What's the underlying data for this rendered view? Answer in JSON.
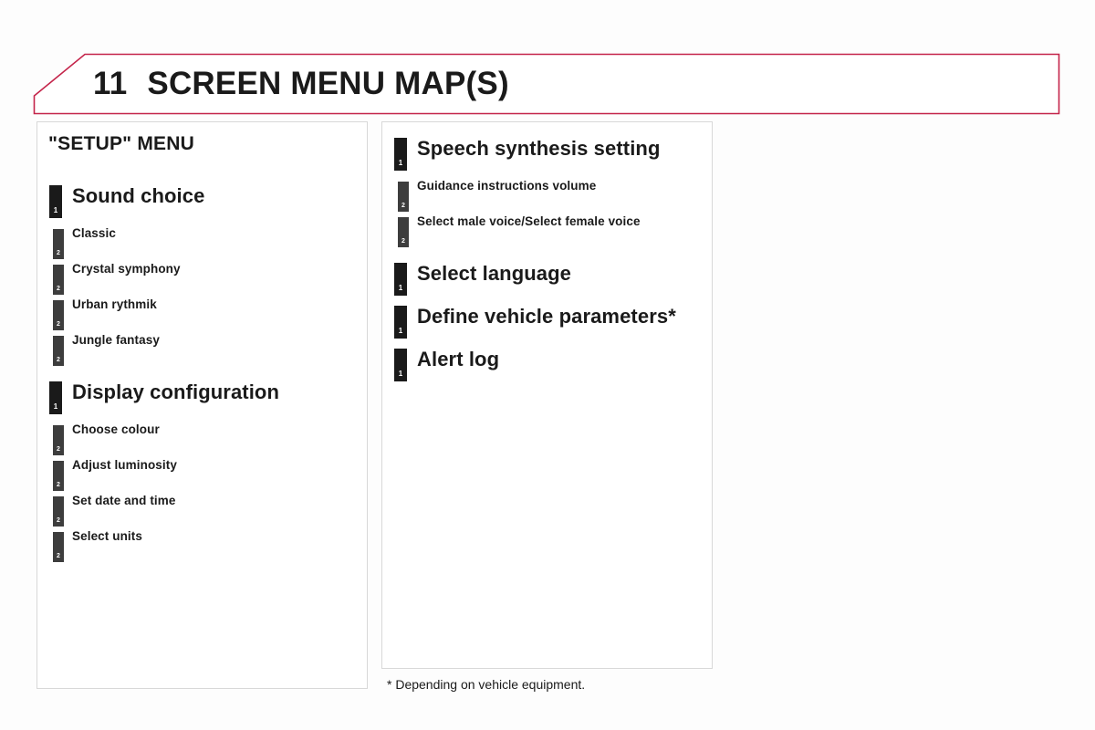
{
  "page": {
    "background_color": "#fdfdfd",
    "accent_color": "#c4244a",
    "marker_level1_color": "#1a1a1a",
    "marker_level2_color": "#3d3d3d"
  },
  "header": {
    "chapter_number": "11",
    "title": "SCREEN MENU MAP(S)"
  },
  "left_panel": {
    "title": "\"SETUP\" MENU",
    "items": [
      {
        "level": "1",
        "marker": "1",
        "label": "Sound choice"
      },
      {
        "level": "2",
        "marker": "2",
        "label": "Classic"
      },
      {
        "level": "2",
        "marker": "2",
        "label": "Crystal symphony"
      },
      {
        "level": "2",
        "marker": "2",
        "label": "Urban rythmik"
      },
      {
        "level": "2",
        "marker": "2",
        "label": "Jungle fantasy"
      },
      {
        "level": "1",
        "marker": "1",
        "label": "Display configuration"
      },
      {
        "level": "2",
        "marker": "2",
        "label": "Choose colour"
      },
      {
        "level": "2",
        "marker": "2",
        "label": "Adjust luminosity"
      },
      {
        "level": "2",
        "marker": "2",
        "label": "Set date and time"
      },
      {
        "level": "2",
        "marker": "2",
        "label": "Select units"
      }
    ]
  },
  "right_panel": {
    "title": "",
    "items": [
      {
        "level": "1",
        "marker": "1",
        "label": "Speech synthesis setting"
      },
      {
        "level": "2",
        "marker": "2",
        "label": "Guidance instructions volume"
      },
      {
        "level": "2",
        "marker": "2",
        "label": "Select male voice/Select female voice"
      },
      {
        "level": "1",
        "marker": "1",
        "label": "Select language"
      },
      {
        "level": "1",
        "marker": "1",
        "label": "Define vehicle parameters*"
      },
      {
        "level": "1",
        "marker": "1",
        "label": "Alert log"
      }
    ]
  },
  "footnote": "* Depending on vehicle equipment."
}
